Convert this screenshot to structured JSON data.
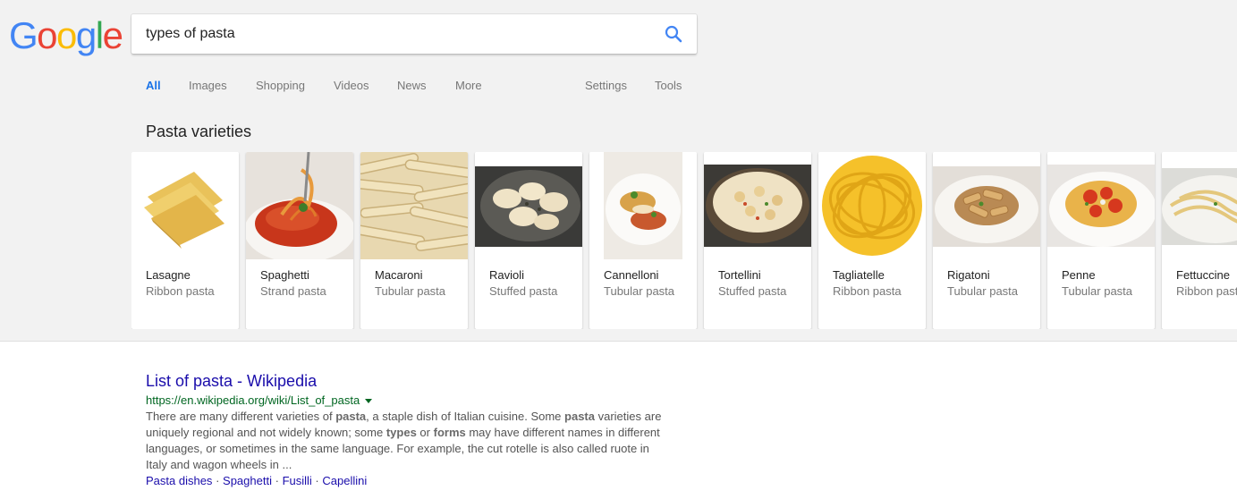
{
  "logo": {
    "letters": [
      "G",
      "o",
      "o",
      "g",
      "l",
      "e"
    ],
    "colors": [
      "#4285f4",
      "#ea4335",
      "#fbbc05",
      "#4285f4",
      "#34a853",
      "#ea4335"
    ]
  },
  "search": {
    "query": "types of pasta",
    "icon": "search-icon",
    "icon_color": "#4285f4"
  },
  "tabs": [
    {
      "label": "All",
      "active": true
    },
    {
      "label": "Images"
    },
    {
      "label": "Shopping"
    },
    {
      "label": "Videos"
    },
    {
      "label": "News"
    },
    {
      "label": "More"
    },
    {
      "label": "Settings"
    },
    {
      "label": "Tools"
    }
  ],
  "carousel": {
    "title": "Pasta varieties",
    "cards": [
      {
        "name": "Lasagne",
        "type": "Ribbon pasta"
      },
      {
        "name": "Spaghetti",
        "type": "Strand pasta"
      },
      {
        "name": "Macaroni",
        "type": "Tubular pasta"
      },
      {
        "name": "Ravioli",
        "type": "Stuffed pasta"
      },
      {
        "name": "Cannelloni",
        "type": "Tubular pasta"
      },
      {
        "name": "Tortellini",
        "type": "Stuffed pasta"
      },
      {
        "name": "Tagliatelle",
        "type": "Ribbon pasta"
      },
      {
        "name": "Rigatoni",
        "type": "Tubular pasta"
      },
      {
        "name": "Penne",
        "type": "Tubular pasta"
      },
      {
        "name": "Fettuccine",
        "type": "Ribbon pasta"
      }
    ]
  },
  "result": {
    "title": "List of pasta - Wikipedia",
    "url": "https://en.wikipedia.org/wiki/List_of_pasta",
    "snippet": {
      "s1": "There are many different varieties of ",
      "b1": "pasta",
      "s2": ", a staple dish of Italian cuisine. Some ",
      "b2": "pasta",
      "s3": " varieties are uniquely regional and not widely known; some ",
      "b3": "types",
      "s4": " or ",
      "b4": "forms",
      "s5": " may have different names in different languages, or sometimes in the same language. For example, the cut rotelle is also called ruote in Italy and wagon wheels in ..."
    },
    "sitelinks": [
      "Pasta dishes",
      "Spaghetti",
      "Fusilli",
      "Capellini"
    ],
    "separator": "·"
  },
  "colors": {
    "link": "#1a0dab",
    "url_green": "#006621",
    "active_tab": "#1a73e8",
    "header_bg": "#f2f2f2"
  }
}
